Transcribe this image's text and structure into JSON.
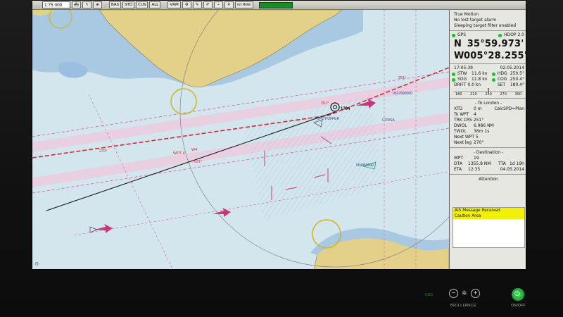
{
  "toolbar": {
    "scale": "1:75 000",
    "buttons": [
      "BAS",
      "STD",
      "CUS",
      "ALL"
    ],
    "vrm_label": "VRM",
    "alt_label": "ALT MENU",
    "icons": [
      "ship-icon",
      "cursor-icon",
      "settings-icon",
      "pencil-icon",
      "brush-icon",
      "crosshair-icon",
      "cancel-icon"
    ]
  },
  "panel": {
    "status": [
      "True Motion",
      "No lost target alarm",
      "Sleeping target filter enabled"
    ],
    "gps_label": "GPS",
    "hdop": "HDOP 2.0",
    "lat_hemi": "N",
    "lat": "35°59.973'",
    "lon_hemi": "W",
    "lon": "005°28.255'",
    "time": "17:05:39",
    "date": "02.05.2014",
    "stw": "STW",
    "stw_val": "11.6 kn",
    "hdg": "HDG",
    "hdg_val": "250.5°",
    "sog": "SOG",
    "sog_val": "11.8 kn",
    "cog": "COG",
    "cog_val": "250.4°",
    "drift": "DRIFT 0.0 kn",
    "set": "SET",
    "set_val": "180.4°",
    "compass_ticks": [
      "180",
      "210",
      "240",
      "270",
      "300"
    ],
    "to_title": "- To London -",
    "xtd": "XTD",
    "xtd_val": "0 m",
    "calc": "CalcSPD=Plan",
    "to_wpt": "To WPT",
    "to_wpt_val": "4",
    "trk": "TRK CRS 251°",
    "dwol": "DWOL",
    "dwol_val": "6.986 NM",
    "twol": "TWOL",
    "twol_val": "36m 1s",
    "next_wpt": "Next WPT 5",
    "next_leg": "Next leg",
    "next_leg_val": "270°",
    "dest_title": "- Destination -",
    "wpt": "WPT",
    "wpt_val": "19",
    "dta": "DTA",
    "dta_val": "1355.8 NM",
    "tta": "TTA",
    "tta_val": "1d 19h",
    "eta": "ETA",
    "eta_time": "12:35",
    "eta_date": "04.05.2014",
    "attention": "Attention",
    "alerts": [
      "AIS Message Received",
      "Caution Area"
    ]
  },
  "chart": {
    "labels": {
      "target_id": "1704",
      "ship_name": "TIPO PUFFER",
      "mmsi_1": "0527890000",
      "mmsi_2": "564950000",
      "vessel_2": "CORSA",
      "wp_label": "WPT 4",
      "wp_next": "W4",
      "course_1": "251°",
      "course_2": "270°",
      "course_3": "071°",
      "course_4": "251°",
      "corner": "(!)"
    }
  },
  "bezel": {
    "hdd": "HDD",
    "brilliance": "BRILLIANCE",
    "minus": "−",
    "plus": "+",
    "onoff": "ON/OFF"
  }
}
